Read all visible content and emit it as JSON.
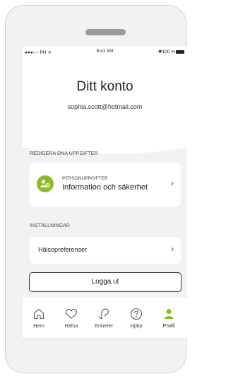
{
  "status_bar": {
    "carrier": "●●●○○ PH ᯤ",
    "time": "9:41 AM",
    "battery": "✱100 %"
  },
  "header": {
    "title": "Ditt konto",
    "email": "sophia.scott@hotmail.com"
  },
  "sections": {
    "edit_label": "REDIGERA DNA UPPGIFTER",
    "personal": {
      "small": "PERSONUPPGIFTER",
      "main": "Information och säkerhet",
      "icon": "user-settings-icon"
    },
    "settings_label": "INSTÄLLNINGAR",
    "health": {
      "label": "Hälsopreferenser"
    }
  },
  "logout_label": "Logga ut",
  "tabs": [
    {
      "label": "Hem",
      "icon": "home-icon"
    },
    {
      "label": "Hälsa",
      "icon": "heart-icon"
    },
    {
      "label": "Enheter",
      "icon": "hearing-aid-icon"
    },
    {
      "label": "Hjälp",
      "icon": "help-icon"
    },
    {
      "label": "Profil",
      "icon": "profile-icon",
      "active": true
    }
  ],
  "colors": {
    "accent": "#8cbd23",
    "background": "#f2f2f2",
    "card": "#ffffff"
  }
}
